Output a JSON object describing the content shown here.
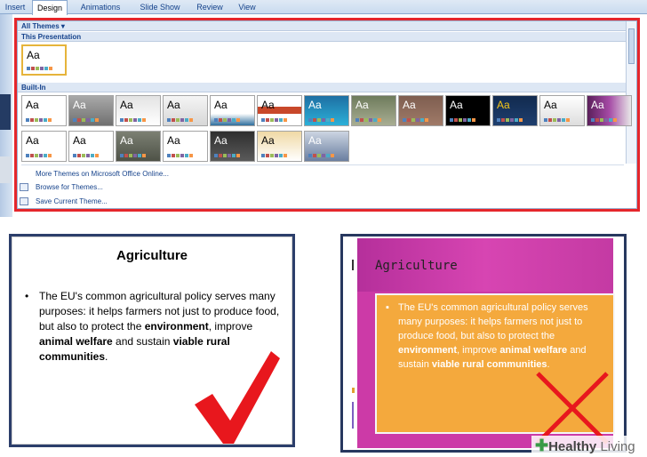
{
  "ribbon": {
    "tabs": [
      "Insert",
      "Design",
      "Animations",
      "Slide Show",
      "Review",
      "View"
    ],
    "active_tab": "Design"
  },
  "gallery": {
    "filter_label": "All Themes",
    "section_this": "This Presentation",
    "section_builtin": "Built-In",
    "thumb_label": "Aa",
    "menu": {
      "more_themes": "More Themes on Microsoft Office Online...",
      "browse": "Browse for Themes...",
      "save": "Save Current Theme..."
    }
  },
  "slide_good": {
    "title": "Agriculture",
    "bullet_text_1": "The EU's common agricultural policy serves many purposes: it helps farmers not just to produce food, but also to protect the ",
    "bold_1": "environment",
    "text_2": ", improve ",
    "bold_2": "animal welfare",
    "text_3": " and sustain ",
    "bold_3": "viable rural communities",
    "text_4": ".",
    "verdict_icon": "checkmark-icon",
    "verdict_color": "#e8171d"
  },
  "slide_bad": {
    "title": "Agriculture",
    "bullet_text_1": "The EU's common agricultural policy serves many purposes: it helps farmers not just to produce food, but also to protect the ",
    "bold_1": "environment",
    "text_2": ", improve ",
    "bold_2": "animal welfare",
    "text_3": " and sustain ",
    "bold_3": "viable rural communities",
    "text_4": ".",
    "verdict_icon": "cross-icon",
    "verdict_color": "#e8171d",
    "background_color": "#cc3aa7",
    "box_color": "#f4a93d"
  },
  "watermark": {
    "brand_bold": "Healthy",
    "brand_light": " Living"
  }
}
